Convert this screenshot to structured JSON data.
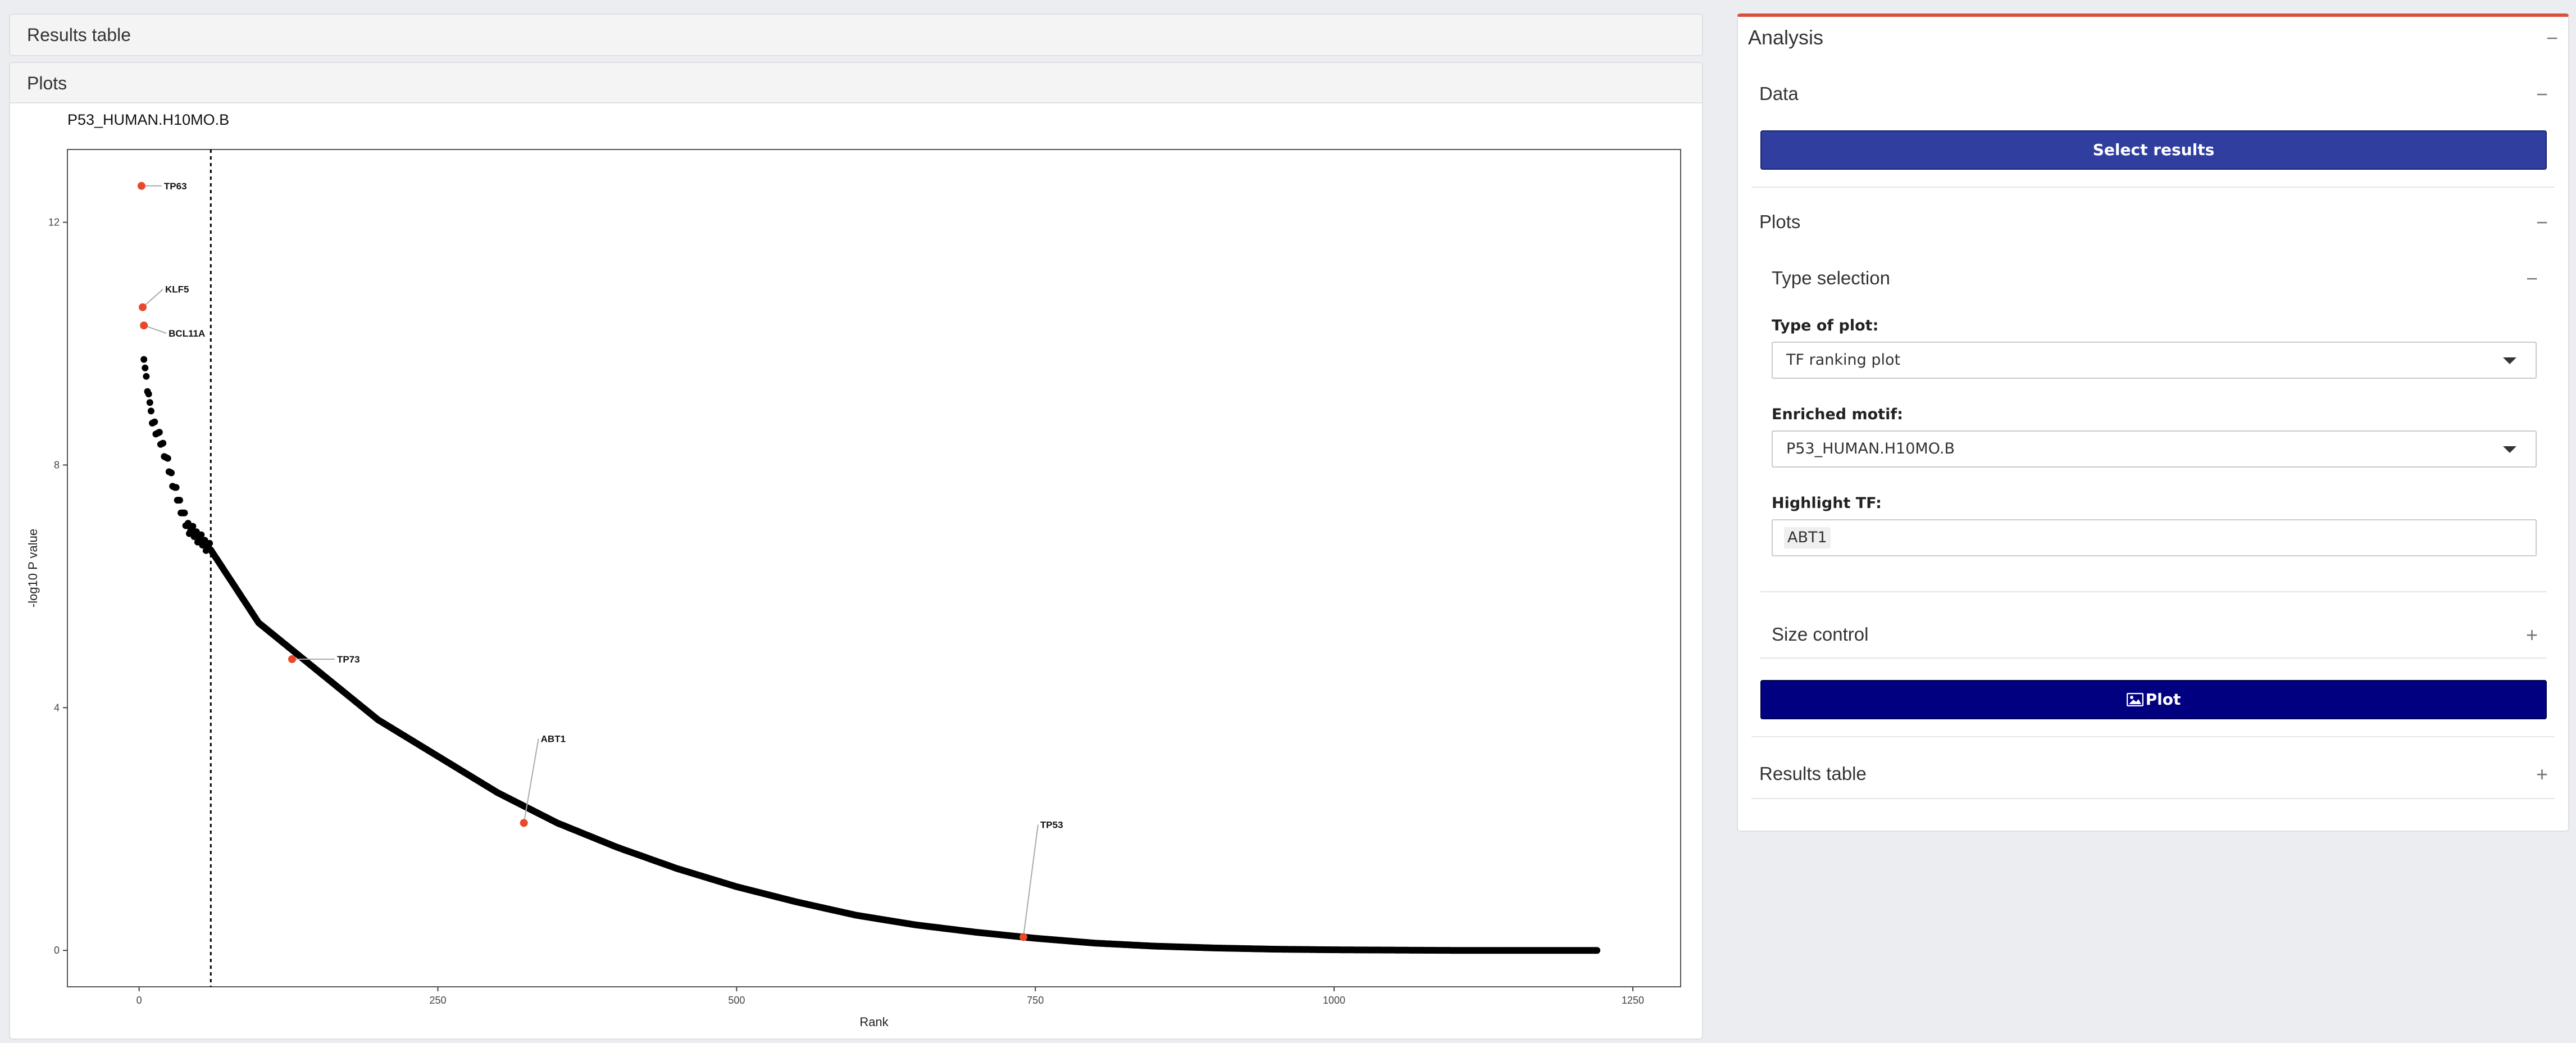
{
  "left": {
    "results_table_title": "Results table",
    "plots_title": "Plots"
  },
  "chart_data": {
    "type": "scatter",
    "title": "P53_HUMAN.H10MO.B",
    "xlabel": "Rank",
    "ylabel": "-log10 P value",
    "xlim": [
      -60,
      1290
    ],
    "ylim": [
      -0.6,
      13.2
    ],
    "xticks": [
      0,
      250,
      500,
      750,
      1000,
      1250
    ],
    "yticks": [
      0,
      4,
      8,
      12
    ],
    "vline_x": 60,
    "n_points": 1220,
    "curve": {
      "x": [
        4,
        6,
        8,
        10,
        12,
        20,
        30,
        40,
        60,
        100,
        150,
        200,
        250,
        300,
        350,
        400,
        450,
        500,
        550,
        600,
        650,
        700,
        750,
        800,
        850,
        900,
        950,
        1000,
        1100,
        1220
      ],
      "y": [
        9.8,
        9.4,
        9.2,
        8.8,
        8.7,
        8.3,
        7.6,
        7.0,
        6.6,
        5.4,
        4.6,
        3.8,
        3.2,
        2.6,
        2.1,
        1.7,
        1.35,
        1.05,
        0.8,
        0.58,
        0.42,
        0.3,
        0.2,
        0.12,
        0.07,
        0.04,
        0.02,
        0.01,
        0.0,
        0.0
      ]
    },
    "highlighted": [
      {
        "label": "TP63",
        "x": 2,
        "y": 12.6
      },
      {
        "label": "KLF5",
        "x": 3,
        "y": 10.6
      },
      {
        "label": "BCL11A",
        "x": 4,
        "y": 10.3
      },
      {
        "label": "TP73",
        "x": 128,
        "y": 4.8
      },
      {
        "label": "ABT1",
        "x": 322,
        "y": 2.1
      },
      {
        "label": "TP53",
        "x": 740,
        "y": 0.22
      }
    ],
    "highlight_color": "#e8482c",
    "point_color": "#000000"
  },
  "panel": {
    "analysis_title": "Analysis",
    "data_title": "Data",
    "select_results_label": "Select results",
    "plots_title": "Plots",
    "type_selection_title": "Type selection",
    "type_of_plot_label": "Type of plot:",
    "type_of_plot_value": "TF ranking plot",
    "enriched_motif_label": "Enriched motif:",
    "enriched_motif_value": "P53_HUMAN.H10MO.B",
    "highlight_tf_label": "Highlight TF:",
    "highlight_tf_value": "ABT1",
    "size_control_title": "Size control",
    "plot_button_label": "Plot",
    "results_table_title": "Results table",
    "collapse_symbol": "−",
    "expand_symbol": "+"
  },
  "colors": {
    "accent_red": "#d94f3d",
    "select_button": "#303f9f",
    "plot_button": "#010080"
  },
  "icons": {
    "plot_button_icon": "image-icon"
  }
}
